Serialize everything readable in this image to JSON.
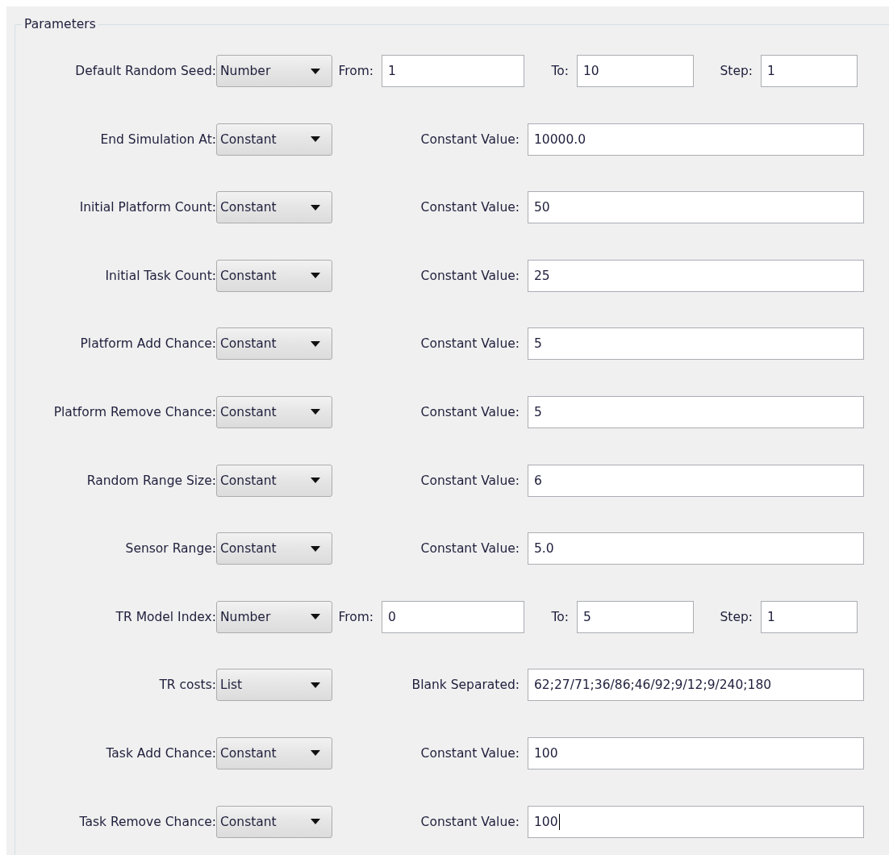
{
  "group": {
    "title": "Parameters"
  },
  "rows": [
    {
      "label": "Default Random Seed:",
      "mode": "Number",
      "kind": "range",
      "fields": [
        {
          "label": "From:",
          "value": "1",
          "focused": false
        },
        {
          "label": "To:",
          "value": "10",
          "focused": false
        },
        {
          "label": "Step:",
          "value": "1",
          "focused": false
        }
      ]
    },
    {
      "label": "End Simulation At:",
      "mode": "Constant",
      "kind": "single",
      "fields": [
        {
          "label": "Constant Value:",
          "value": "10000.0",
          "focused": false
        }
      ]
    },
    {
      "label": "Initial Platform Count:",
      "mode": "Constant",
      "kind": "single",
      "fields": [
        {
          "label": "Constant Value:",
          "value": "50",
          "focused": false
        }
      ]
    },
    {
      "label": "Initial Task Count:",
      "mode": "Constant",
      "kind": "single",
      "fields": [
        {
          "label": "Constant Value:",
          "value": "25",
          "focused": false
        }
      ]
    },
    {
      "label": "Platform Add Chance:",
      "mode": "Constant",
      "kind": "single",
      "fields": [
        {
          "label": "Constant Value:",
          "value": "5",
          "focused": false
        }
      ]
    },
    {
      "label": "Platform Remove Chance:",
      "mode": "Constant",
      "kind": "single",
      "fields": [
        {
          "label": "Constant Value:",
          "value": "5",
          "focused": false
        }
      ]
    },
    {
      "label": "Random Range Size:",
      "mode": "Constant",
      "kind": "single",
      "fields": [
        {
          "label": "Constant Value:",
          "value": "6",
          "focused": false
        }
      ]
    },
    {
      "label": "Sensor Range:",
      "mode": "Constant",
      "kind": "single",
      "fields": [
        {
          "label": "Constant Value:",
          "value": "5.0",
          "focused": false
        }
      ]
    },
    {
      "label": "TR Model Index:",
      "mode": "Number",
      "kind": "range",
      "fields": [
        {
          "label": "From:",
          "value": "0",
          "focused": false
        },
        {
          "label": "To:",
          "value": "5",
          "focused": false
        },
        {
          "label": "Step:",
          "value": "1",
          "focused": false
        }
      ]
    },
    {
      "label": "TR costs:",
      "mode": "List",
      "kind": "single",
      "fields": [
        {
          "label": "Blank Separated:",
          "value": "62;27/71;36/86;46/92;9/12;9/240;180",
          "focused": false
        }
      ]
    },
    {
      "label": "Task Add Chance:",
      "mode": "Constant",
      "kind": "single",
      "fields": [
        {
          "label": "Constant Value:",
          "value": "100",
          "focused": false
        }
      ]
    },
    {
      "label": "Task Remove Chance:",
      "mode": "Constant",
      "kind": "single",
      "fields": [
        {
          "label": "Constant Value:",
          "value": "100",
          "focused": true
        }
      ]
    }
  ]
}
